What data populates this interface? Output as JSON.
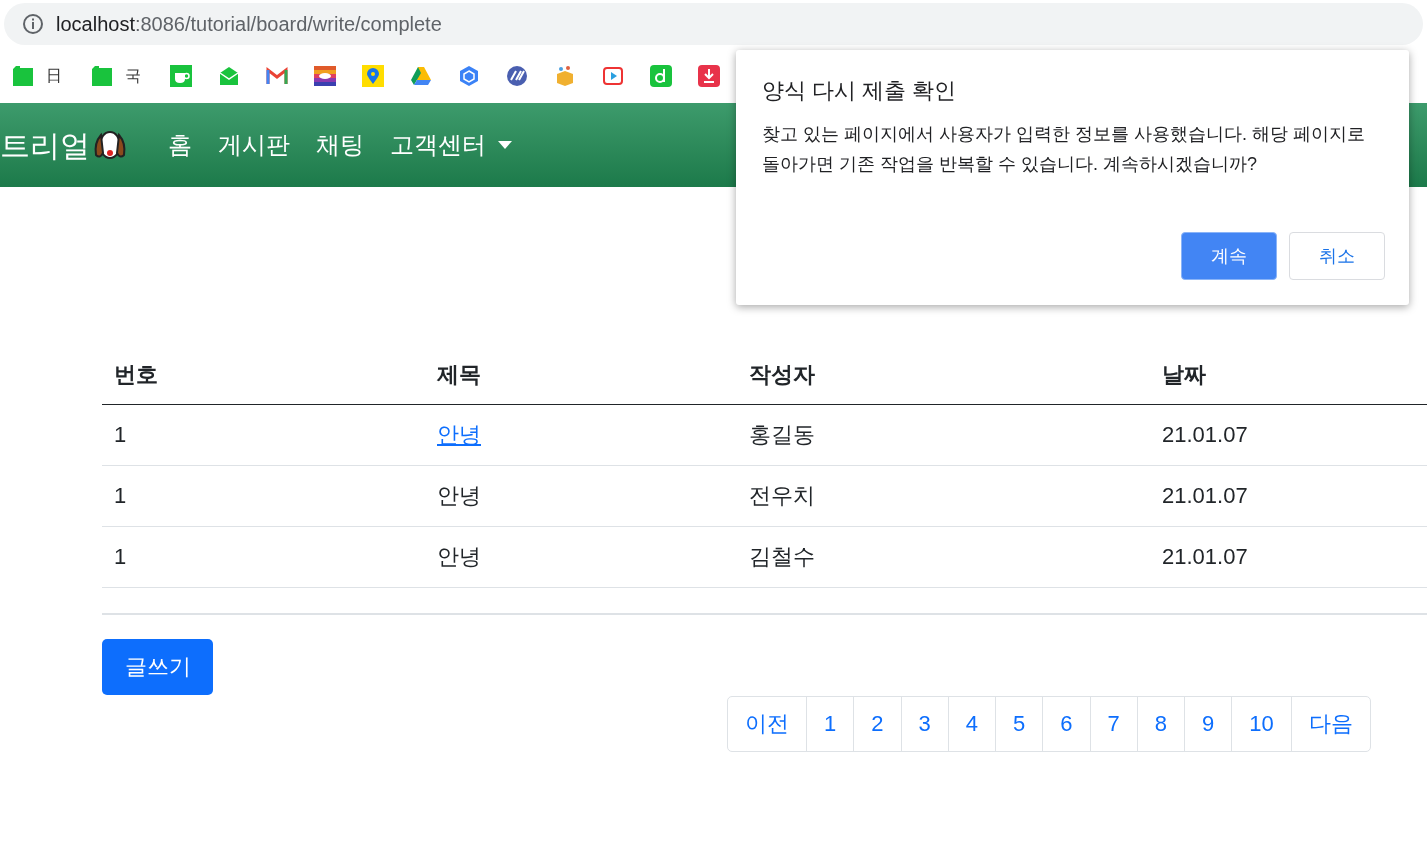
{
  "address_bar": {
    "host": "localhost",
    "path": ":8086/tutorial/board/write/complete"
  },
  "bookmarks": [
    {
      "label": "日"
    },
    {
      "label": "국"
    }
  ],
  "navbar": {
    "brand": "트리얼",
    "links": [
      {
        "label": "홈",
        "dropdown": false
      },
      {
        "label": "게시판",
        "dropdown": false
      },
      {
        "label": "채팅",
        "dropdown": false
      },
      {
        "label": "고객센터",
        "dropdown": true
      }
    ]
  },
  "table": {
    "columns": [
      "번호",
      "제목",
      "작성자",
      "날짜"
    ],
    "rows": [
      {
        "number": "1",
        "title": "안녕",
        "title_link": true,
        "author": "홍길동",
        "date": "21.01.07"
      },
      {
        "number": "1",
        "title": "안녕",
        "title_link": false,
        "author": "전우치",
        "date": "21.01.07"
      },
      {
        "number": "1",
        "title": "안녕",
        "title_link": false,
        "author": "김철수",
        "date": "21.01.07"
      }
    ]
  },
  "write_button": "글쓰기",
  "pagination": [
    "이전",
    "1",
    "2",
    "3",
    "4",
    "5",
    "6",
    "7",
    "8",
    "9",
    "10",
    "다음"
  ],
  "dialog": {
    "title": "양식 다시 제출 확인",
    "message": "찾고 있는 페이지에서 사용자가 입력한 정보를 사용했습니다. 해당 페이지로 돌아가면 기존 작업을 반복할 수 있습니다. 계속하시겠습니까?",
    "buttons": [
      {
        "label": "계속",
        "kind": "primary"
      },
      {
        "label": "취소",
        "kind": "secondary"
      }
    ]
  }
}
